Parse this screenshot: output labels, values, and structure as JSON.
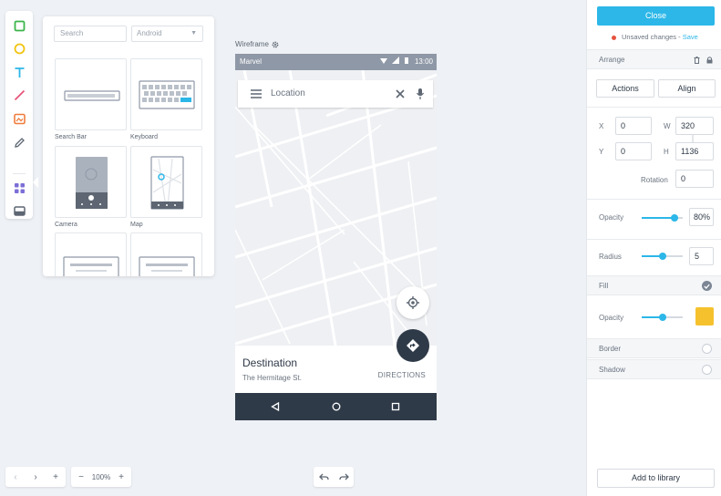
{
  "toolbar": {
    "tools": [
      {
        "icon": "rectangle-icon",
        "color": "#3bb54a"
      },
      {
        "icon": "ellipse-icon",
        "color": "#f1c40f"
      },
      {
        "icon": "text-icon",
        "color": "#2cb7e8"
      },
      {
        "icon": "line-icon",
        "color": "#e8557a"
      },
      {
        "icon": "image-icon",
        "color": "#f07c3c"
      },
      {
        "icon": "pen-icon",
        "color": "#5d6672"
      },
      {
        "icon": "components-icon",
        "color": "#7b6fd6"
      },
      {
        "icon": "tray-icon",
        "color": "#5d6672"
      }
    ]
  },
  "library": {
    "search_placeholder": "Search",
    "platform_select": "Android",
    "components": [
      {
        "label": "Search Bar",
        "icon": "search-bar-thumb"
      },
      {
        "label": "Keyboard",
        "icon": "keyboard-thumb"
      },
      {
        "label": "Camera",
        "icon": "camera-thumb"
      },
      {
        "label": "Map",
        "icon": "map-thumb"
      },
      {
        "label": "",
        "icon": "dialog-thumb"
      },
      {
        "label": "",
        "icon": "dialog-thumb"
      }
    ]
  },
  "canvas": {
    "frame_label": "Wireframe",
    "status_carrier": "Marvel",
    "status_time": "13:00",
    "search_placeholder": "Location",
    "destination_title": "Destination",
    "destination_subtitle": "The Hermitage St.",
    "directions_label": "DIRECTIONS"
  },
  "bottom_controls": {
    "zoom_value": "100%"
  },
  "panel": {
    "close_label": "Close",
    "unsaved_text": "Unsaved changes -",
    "save_link": "Save",
    "arrange_label": "Arrange",
    "actions_label": "Actions",
    "align_label": "Align",
    "x_label": "X",
    "x_value": "0",
    "w_label": "W",
    "w_value": "320",
    "y_label": "Y",
    "y_value": "0",
    "h_label": "H",
    "h_value": "1136",
    "rotation_label": "Rotation",
    "rotation_value": "0",
    "opacity_label": "Opacity",
    "opacity_value": "80%",
    "opacity_level": 0.8,
    "radius_label": "Radius",
    "radius_value": "5",
    "radius_level": 0.5,
    "fill_label": "Fill",
    "fill_opacity_label": "Opacity",
    "fill_opacity_level": 0.5,
    "fill_color": "#f5c22e",
    "border_label": "Border",
    "shadow_label": "Shadow",
    "add_library_label": "Add to library"
  },
  "colors": {
    "accent": "#2cb7e8",
    "dark": "#2f3a48",
    "unsaved_dot": "#e5533d"
  }
}
